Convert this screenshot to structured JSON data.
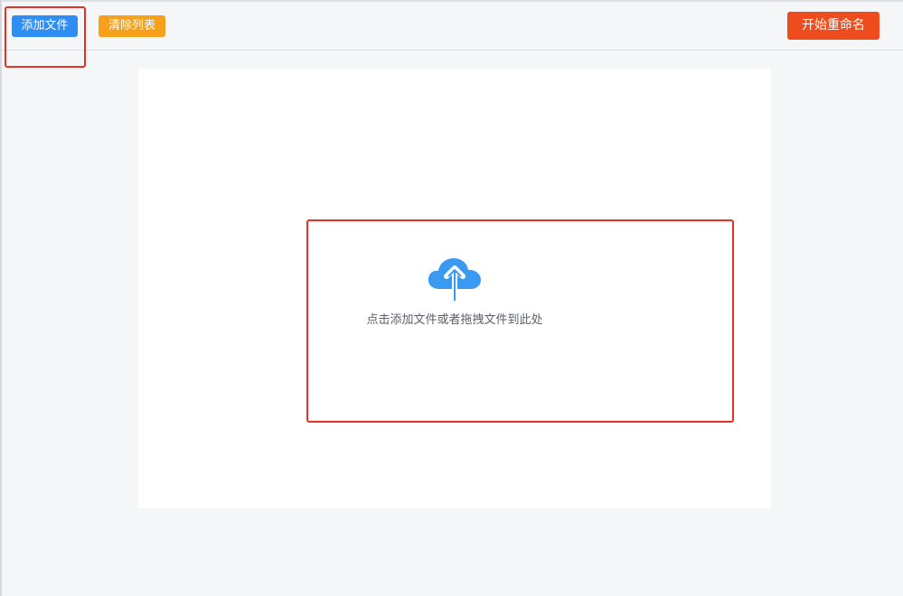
{
  "toolbar": {
    "add_file_label": "添加文件",
    "clear_list_label": "清除列表",
    "start_rename_label": "开始重命名"
  },
  "dropzone": {
    "icon": "cloud-upload-icon",
    "hint": "点击添加文件或者拖拽文件到此处"
  },
  "colors": {
    "add_button": "#2f8ef4",
    "clear_button": "#f7a11a",
    "rename_button": "#ee4c1d",
    "highlight": "#e53226",
    "upload_icon": "#3a9af2"
  }
}
